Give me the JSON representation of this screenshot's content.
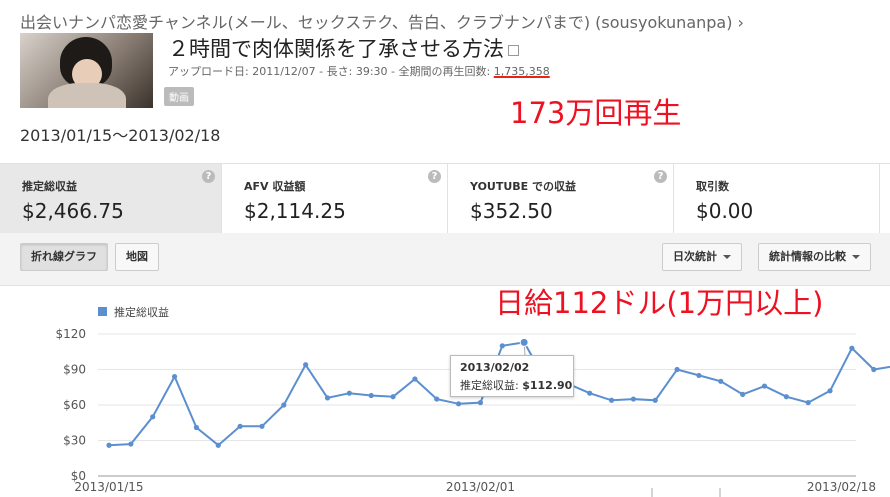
{
  "header": {
    "breadcrumb": "出会いナンパ恋愛チャンネル(メール、セックステク、告白、クラブナンパまで) (sousyokunanpa) ›",
    "video_title": "２時間で肉体関係を了承させる方法",
    "upload_label": "アップロード日:",
    "upload_date": "2011/12/07",
    "length_label": "長さ:",
    "length": "39:30",
    "views_label": "全期間の再生回数:",
    "views": "1,735,358",
    "sep": "-",
    "badge": "動画"
  },
  "annotations": {
    "views_note": "173万回再生",
    "daily_note": "日給112ドル(1万円以上)"
  },
  "date_range": "2013/01/15〜2013/02/18",
  "metrics": [
    {
      "label": "推定総収益",
      "value": "$2,466.75",
      "selected": true
    },
    {
      "label": "AFV 収益額",
      "value": "$2,114.25",
      "selected": false
    },
    {
      "label": "YOUTUBE での収益",
      "value": "$352.50",
      "selected": false
    },
    {
      "label": "取引数",
      "value": "$0.00",
      "selected": false
    }
  ],
  "help_glyph": "?",
  "toolbar": {
    "line_graph": "折れ線グラフ",
    "map": "地図",
    "daily_stats": "日次統計",
    "compare": "統計情報の比較"
  },
  "tooltip": {
    "date": "2013/02/02",
    "label": "推定総収益:",
    "value": "$112.90"
  },
  "chart_data": {
    "type": "line",
    "series": [
      {
        "name": "推定総収益",
        "color": "#5b8fd0",
        "values": [
          26,
          27,
          50,
          84,
          41,
          26,
          42,
          42,
          60,
          94,
          66,
          70,
          68,
          67,
          82,
          65,
          61,
          62,
          110,
          112.9,
          80,
          78,
          70,
          64,
          65,
          64,
          90,
          85,
          80,
          69,
          76,
          67,
          62,
          72,
          108,
          90,
          93
        ]
      }
    ],
    "x_start": "2013/01/15",
    "x_end": "2013/02/20",
    "x_tick_labels": [
      "2013/01/15",
      "2013/02/01",
      "2013/02/18"
    ],
    "y_tick_labels": [
      "$0",
      "$30",
      "$60",
      "$90",
      "$120"
    ],
    "ylim": [
      0,
      120
    ],
    "grid": true,
    "legend": "top-left"
  }
}
